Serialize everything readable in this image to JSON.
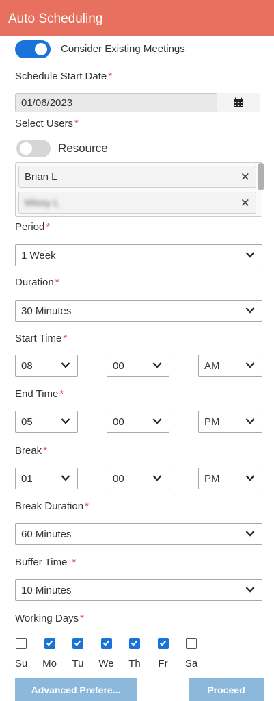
{
  "header": {
    "title": "Auto Scheduling"
  },
  "consider": {
    "label": "Consider Existing Meetings",
    "enabled": true
  },
  "start_date": {
    "label": "Schedule Start Date",
    "value": "01/06/2023"
  },
  "users": {
    "label": "Select Users",
    "resource_label": "Resource",
    "resource_enabled": false,
    "selected": [
      {
        "name": "Brian L"
      },
      {
        "name": "Missy L"
      }
    ]
  },
  "period": {
    "label": "Period",
    "value": "1 Week"
  },
  "duration": {
    "label": "Duration",
    "value": "30 Minutes"
  },
  "start_time": {
    "label": "Start Time",
    "hour": "08",
    "minute": "00",
    "ampm": "AM"
  },
  "end_time": {
    "label": "End Time",
    "hour": "05",
    "minute": "00",
    "ampm": "PM"
  },
  "break": {
    "label": "Break",
    "hour": "01",
    "minute": "00",
    "ampm": "PM"
  },
  "break_duration": {
    "label": "Break Duration",
    "value": "60 Minutes"
  },
  "buffer_time": {
    "label": "Buffer Time",
    "value": "10 Minutes"
  },
  "working_days": {
    "label": "Working Days",
    "days": [
      {
        "label": "Su",
        "checked": false
      },
      {
        "label": "Mo",
        "checked": true
      },
      {
        "label": "Tu",
        "checked": true
      },
      {
        "label": "We",
        "checked": true
      },
      {
        "label": "Th",
        "checked": true
      },
      {
        "label": "Fr",
        "checked": true
      },
      {
        "label": "Sa",
        "checked": false
      }
    ]
  },
  "buttons": {
    "advanced": "Advanced Prefere...",
    "proceed": "Proceed"
  },
  "colors": {
    "header": "#e8705e",
    "accent": "#1a73d9",
    "button": "#8cb8dc",
    "required": "#e05050"
  },
  "icons": {
    "calendar": "calendar-icon",
    "remove": "close-icon",
    "dropdown": "chevron-down-icon",
    "check": "check-icon"
  }
}
